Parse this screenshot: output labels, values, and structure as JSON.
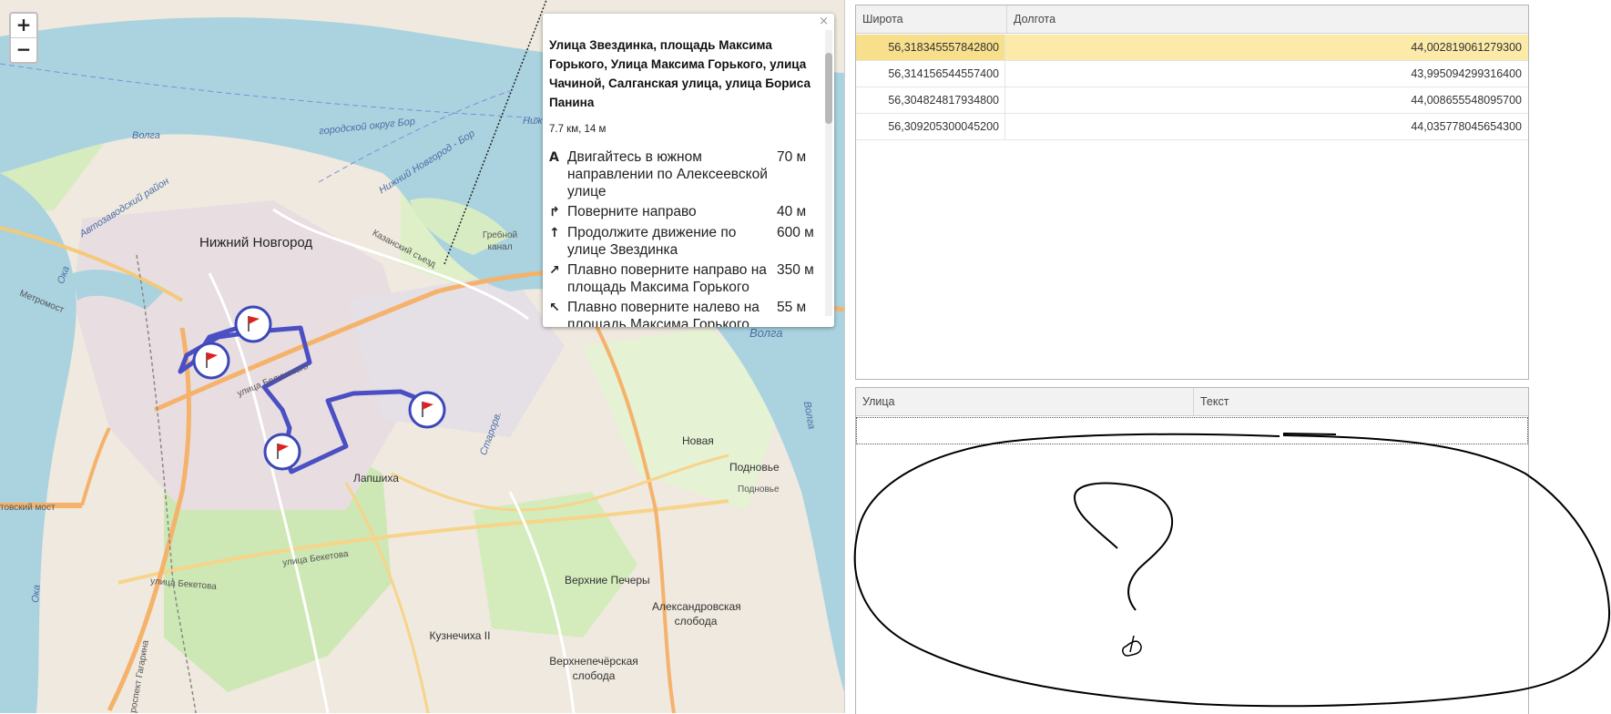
{
  "map": {
    "zoom_in_label": "+",
    "zoom_out_label": "−",
    "labels": {
      "city": "Нижний Новгород",
      "lapshikha": "Лапшиха",
      "novaya": "Новая",
      "podnovye": "Подновье",
      "podnovye_small": "Подновье",
      "verkhnie_pechery": "Верхние Печеры",
      "aleksandrovskaya": "Александровская слобода",
      "verkhnepecherskaya": "Верхнепечёрская слобода",
      "kuznechikha": "Кузнечиха II",
      "volga_1": "Волга",
      "volga_2": "Волга",
      "volga_3": "Волга",
      "oka_1": "Ока",
      "oka_2": "Ока",
      "grebnoy": "Гребной канал",
      "gorodskoy_okrug": "городской округ Бор",
      "nizhny_novgorod_road": "Нижний Новгород - Бор",
      "avtozavod": "Автозаводский район",
      "ul_belinskogo": "улица Белинского",
      "ul_beketova": "улица Бекетова",
      "ul_beketova_2": "улица Бекетова",
      "ul_gagarina": "проспект Гагарина",
      "metromost": "Метромост",
      "kazansky": "Казанский съезд",
      "ovrag": "Старорв.",
      "molitovsky": "товский мост",
      "nizh": "Ниж"
    },
    "markers": [
      "route-marker-1",
      "route-marker-2",
      "route-marker-3",
      "route-marker-4"
    ],
    "colors": {
      "route": "#4b4fc4",
      "water": "#aad3df",
      "marker_border": "#3c48b8",
      "flag": "#d22"
    }
  },
  "popup": {
    "close_label": "×",
    "title": "Улица Звездинка, площадь Максима Горького, Улица Максима Горького, улица Чачиной, Салганская улица, улица Бориса Панина",
    "summary": "7.7 км, 14 м",
    "steps": [
      {
        "icon": "A",
        "text": "Двигайтесь в южном направлении по Алексеевской улице",
        "distance": "70 м"
      },
      {
        "icon": "↱",
        "text": "Поверните направо",
        "distance": "40 м"
      },
      {
        "icon": "↑",
        "text": "Продолжите движение по улице Звездинка",
        "distance": "600 м"
      },
      {
        "icon": "↗",
        "text": "Плавно поверните направо на площадь Максима Горького",
        "distance": "350 м"
      },
      {
        "icon": "↖",
        "text": "Плавно поверните налево на площадь Максима Горького",
        "distance": "55 м"
      }
    ]
  },
  "coords_table": {
    "headers": [
      "Широта",
      "Долгота"
    ],
    "rows": [
      {
        "lat": "56,318345557842800",
        "lon": "44,002819061279300",
        "selected": true
      },
      {
        "lat": "56,314156544557400",
        "lon": "43,995094299316400",
        "selected": false
      },
      {
        "lat": "56,304824817934800",
        "lon": "44,008655548095700",
        "selected": false
      },
      {
        "lat": "56,309205300045200",
        "lon": "44,035778045654300",
        "selected": false
      }
    ]
  },
  "streets_table": {
    "headers": [
      "Улица",
      "Текст"
    ],
    "rows": [
      {
        "street": "",
        "text": ""
      }
    ]
  }
}
